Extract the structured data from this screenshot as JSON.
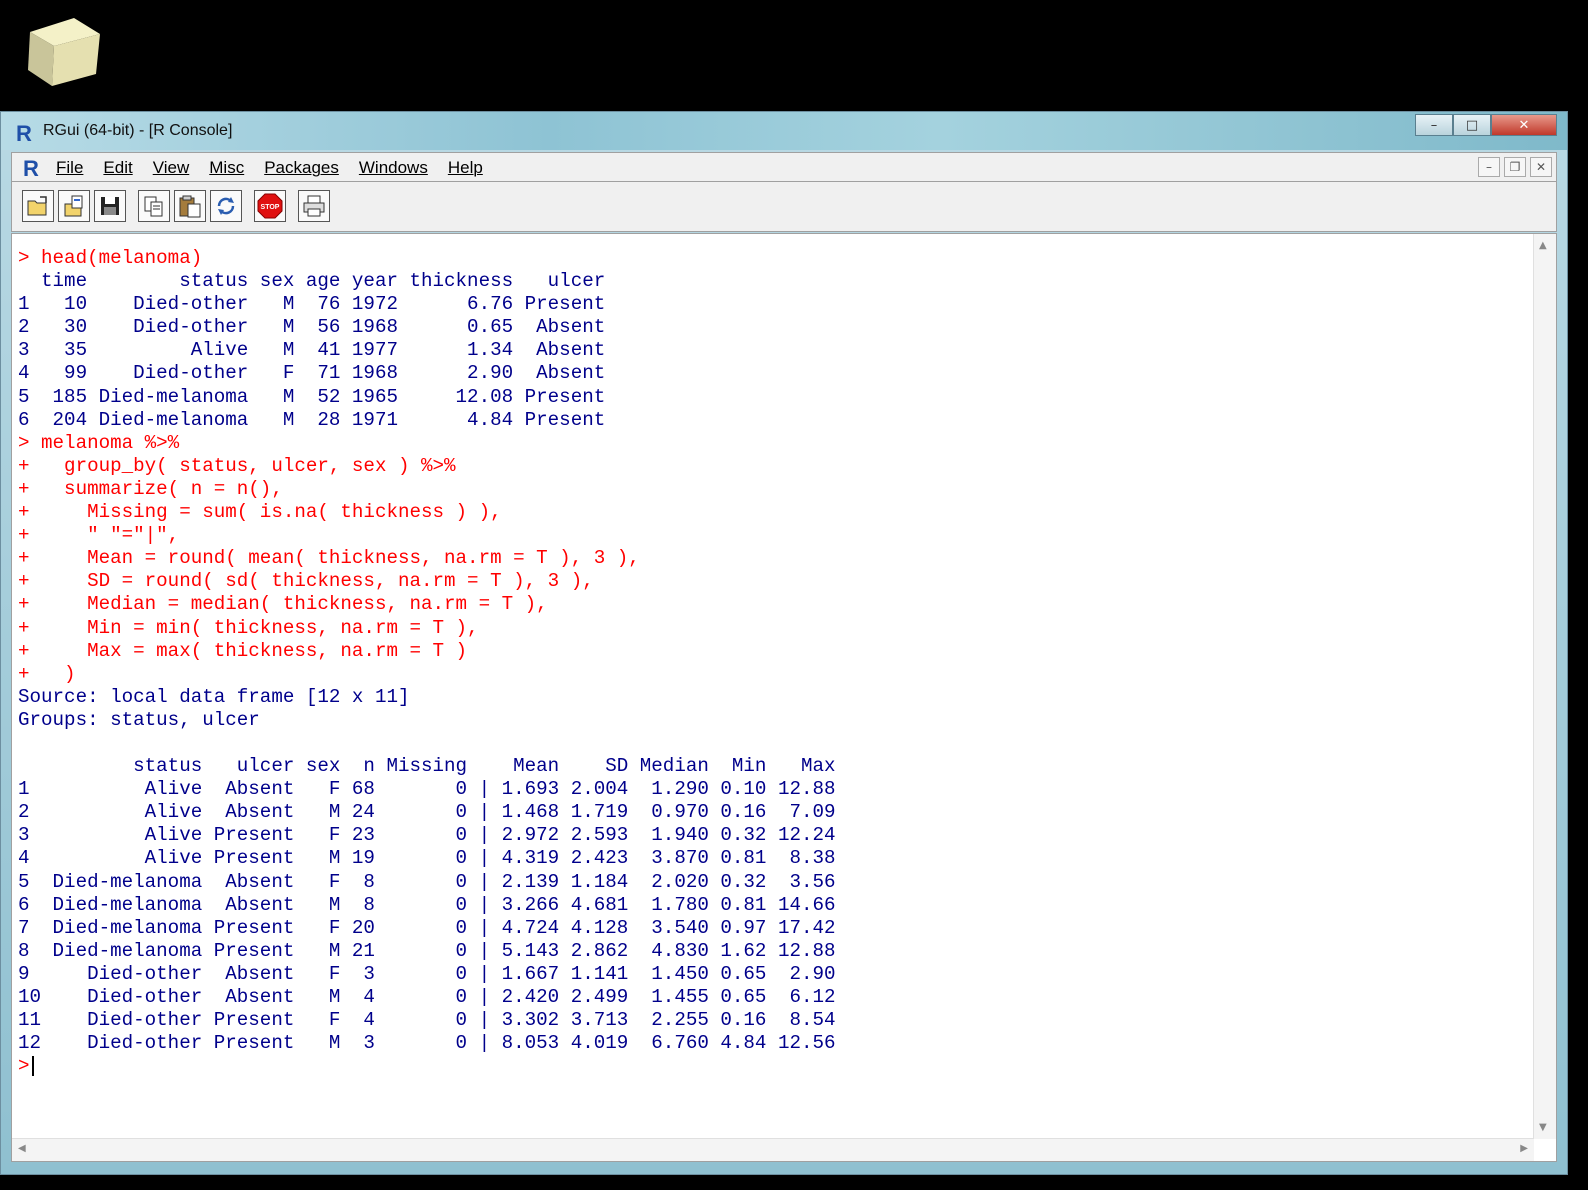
{
  "window": {
    "title": "RGui (64-bit) - [R Console]"
  },
  "menu": {
    "items": [
      "File",
      "Edit",
      "View",
      "Misc",
      "Packages",
      "Windows",
      "Help"
    ]
  },
  "toolbar": {
    "buttons": [
      "open-script-icon",
      "load-workspace-icon",
      "save-icon",
      "copy-icon",
      "paste-icon",
      "refresh-icon",
      "stop-icon",
      "print-icon"
    ]
  },
  "console": {
    "lines": [
      {
        "type": "command",
        "text": "> head(melanoma)"
      },
      {
        "type": "output",
        "text": "  time        status sex age year thickness   ulcer"
      },
      {
        "type": "output",
        "text": "1   10    Died-other   M  76 1972      6.76 Present"
      },
      {
        "type": "output",
        "text": "2   30    Died-other   M  56 1968      0.65  Absent"
      },
      {
        "type": "output",
        "text": "3   35         Alive   M  41 1977      1.34  Absent"
      },
      {
        "type": "output",
        "text": "4   99    Died-other   F  71 1968      2.90  Absent"
      },
      {
        "type": "output",
        "text": "5  185 Died-melanoma   M  52 1965     12.08 Present"
      },
      {
        "type": "output",
        "text": "6  204 Died-melanoma   M  28 1971      4.84 Present"
      },
      {
        "type": "command",
        "text": "> melanoma %>%"
      },
      {
        "type": "command",
        "text": "+   group_by( status, ulcer, sex ) %>%"
      },
      {
        "type": "command",
        "text": "+   summarize( n = n(),"
      },
      {
        "type": "command",
        "text": "+     Missing = sum( is.na( thickness ) ),"
      },
      {
        "type": "command",
        "text": "+     \" \"=\"|\","
      },
      {
        "type": "command",
        "text": "+     Mean = round( mean( thickness, na.rm = T ), 3 ),"
      },
      {
        "type": "command",
        "text": "+     SD = round( sd( thickness, na.rm = T ), 3 ),"
      },
      {
        "type": "command",
        "text": "+     Median = median( thickness, na.rm = T ),"
      },
      {
        "type": "command",
        "text": "+     Min = min( thickness, na.rm = T ),"
      },
      {
        "type": "command",
        "text": "+     Max = max( thickness, na.rm = T )"
      },
      {
        "type": "command",
        "text": "+   )"
      },
      {
        "type": "output",
        "text": "Source: local data frame [12 x 11]"
      },
      {
        "type": "output",
        "text": "Groups: status, ulcer"
      },
      {
        "type": "output",
        "text": ""
      },
      {
        "type": "output",
        "text": "          status   ulcer sex  n Missing    Mean    SD Median  Min   Max"
      },
      {
        "type": "output",
        "text": "1          Alive  Absent   F 68       0 | 1.693 2.004  1.290 0.10 12.88"
      },
      {
        "type": "output",
        "text": "2          Alive  Absent   M 24       0 | 1.468 1.719  0.970 0.16  7.09"
      },
      {
        "type": "output",
        "text": "3          Alive Present   F 23       0 | 2.972 2.593  1.940 0.32 12.24"
      },
      {
        "type": "output",
        "text": "4          Alive Present   M 19       0 | 4.319 2.423  3.870 0.81  8.38"
      },
      {
        "type": "output",
        "text": "5  Died-melanoma  Absent   F  8       0 | 2.139 1.184  2.020 0.32  3.56"
      },
      {
        "type": "output",
        "text": "6  Died-melanoma  Absent   M  8       0 | 3.266 4.681  1.780 0.81 14.66"
      },
      {
        "type": "output",
        "text": "7  Died-melanoma Present   F 20       0 | 4.724 4.128  3.540 0.97 17.42"
      },
      {
        "type": "output",
        "text": "8  Died-melanoma Present   M 21       0 | 5.143 2.862  4.830 1.62 12.88"
      },
      {
        "type": "output",
        "text": "9     Died-other  Absent   F  3       0 | 1.667 1.141  1.450 0.65  2.90"
      },
      {
        "type": "output",
        "text": "10    Died-other  Absent   M  4       0 | 2.420 2.499  1.455 0.65  6.12"
      },
      {
        "type": "output",
        "text": "11    Died-other Present   F  4       0 | 3.302 3.713  2.255 0.16  8.54"
      },
      {
        "type": "output",
        "text": "12    Died-other Present   M  3       0 | 8.053 4.019  6.760 4.84 12.56"
      }
    ],
    "prompt": ">"
  },
  "colors": {
    "command": "#ff0000",
    "output": "#00008b",
    "window_frame": "#9fcbd8"
  }
}
